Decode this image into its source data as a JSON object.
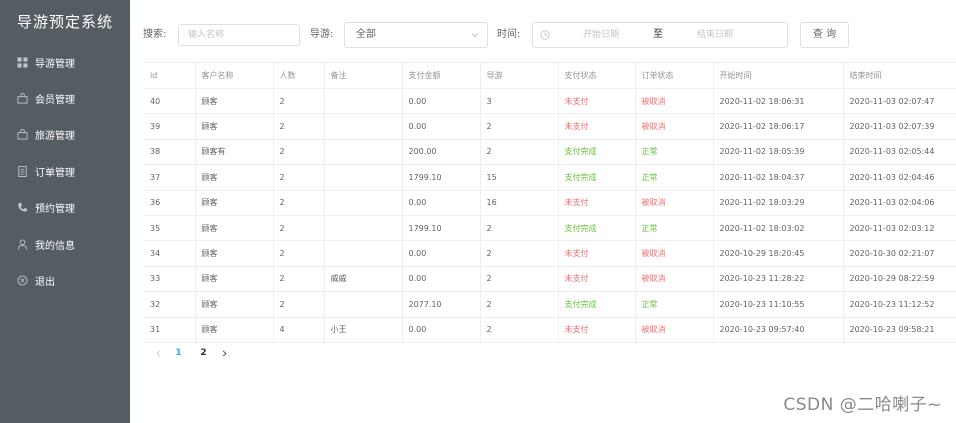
{
  "sidebar": {
    "title": "导游预定系统",
    "items": [
      {
        "label": "导游管理",
        "icon": "grid-icon"
      },
      {
        "label": "会员管理",
        "icon": "bag-icon"
      },
      {
        "label": "旅游管理",
        "icon": "bag-icon"
      },
      {
        "label": "订单管理",
        "icon": "document-icon"
      },
      {
        "label": "预约管理",
        "icon": "phone-icon"
      },
      {
        "label": "我的信息",
        "icon": "user-icon"
      },
      {
        "label": "退出",
        "icon": "close-circle-icon"
      }
    ]
  },
  "toolbar": {
    "search_label": "搜索:",
    "search_placeholder": "输入名称",
    "guide_label": "导游:",
    "guide_value": "全部",
    "time_label": "时间:",
    "start_placeholder": "开始日期",
    "range_sep": "至",
    "end_placeholder": "结束日期",
    "query_button": "查 询"
  },
  "table": {
    "headers": [
      "id",
      "客户名称",
      "人数",
      "备注",
      "支付金额",
      "导游",
      "支付状态",
      "订单状态",
      "开始时间",
      "结束时间"
    ],
    "rows": [
      [
        "40",
        "顾客",
        "2",
        "",
        "0.00",
        "3",
        "未支付",
        "被取消",
        "2020-11-02 18:06:31",
        "2020-11-03 02:07:47"
      ],
      [
        "39",
        "顾客",
        "2",
        "",
        "0.00",
        "2",
        "未支付",
        "被取消",
        "2020-11-02 18:06:17",
        "2020-11-03 02:07:39"
      ],
      [
        "38",
        "顾客有",
        "2",
        "",
        "200.00",
        "2",
        "支付完成",
        "正常",
        "2020-11-02 18:05:39",
        "2020-11-03 02:05:44"
      ],
      [
        "37",
        "顾客",
        "2",
        "",
        "1799.10",
        "15",
        "支付完成",
        "正常",
        "2020-11-02 18:04:37",
        "2020-11-03 02:04:46"
      ],
      [
        "36",
        "顾客",
        "2",
        "",
        "0.00",
        "16",
        "未支付",
        "被取消",
        "2020-11-02 18:03:29",
        "2020-11-03 02:04:06"
      ],
      [
        "35",
        "顾客",
        "2",
        "",
        "1799.10",
        "2",
        "支付完成",
        "正常",
        "2020-11-02 18:03:02",
        "2020-11-03 02:03:12"
      ],
      [
        "34",
        "顾客",
        "2",
        "",
        "0.00",
        "2",
        "未支付",
        "被取消",
        "2020-10-29 18:20:45",
        "2020-10-30 02:21:07"
      ],
      [
        "33",
        "顾客",
        "2",
        "威威",
        "0.00",
        "2",
        "未支付",
        "被取消",
        "2020-10-23 11:28:22",
        "2020-10-29 08:22:59"
      ],
      [
        "32",
        "顾客",
        "2",
        "",
        "2077.10",
        "2",
        "支付完成",
        "正常",
        "2020-10-23 11:10:55",
        "2020-10-23 11:12:52"
      ],
      [
        "31",
        "顾客",
        "4",
        "小王",
        "0.00",
        "2",
        "未支付",
        "被取消",
        "2020-10-23 09:57:40",
        "2020-10-23 09:58:21"
      ]
    ]
  },
  "pagination": {
    "pages": [
      "1",
      "2"
    ],
    "current": "1"
  },
  "watermark": "CSDN @二哈喇子~",
  "colors": {
    "sidebar_bg": "#545c64",
    "unpaid": "#f56c6c",
    "paid": "#67c23a",
    "active_page": "#409eff"
  }
}
